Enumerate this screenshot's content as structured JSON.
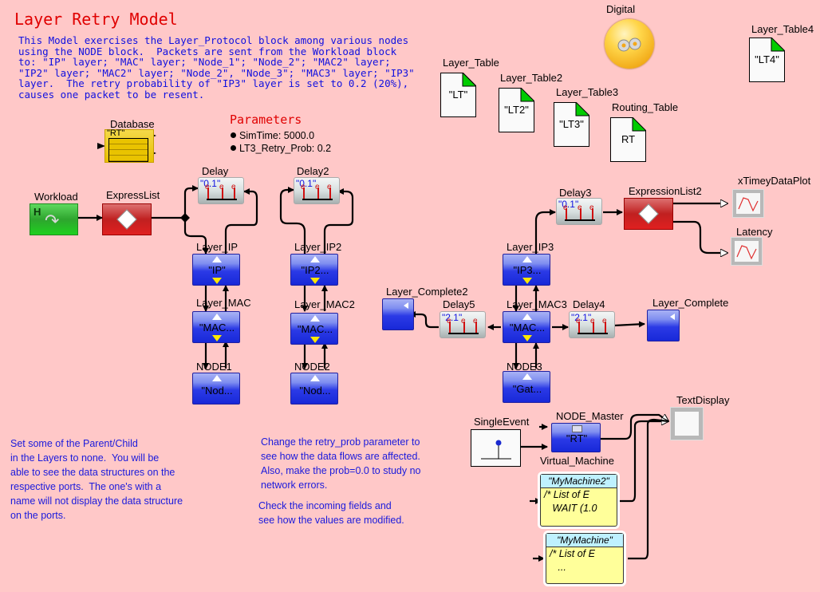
{
  "title": "Layer Retry Model",
  "description": "This Model exercises the Layer_Protocol block among various nodes\nusing the NODE block.  Packets are sent from the Workload block\nto: \"IP\" layer; \"MAC\" layer; \"Node_1\"; \"Node_2\"; \"MAC2\" layer;\n\"IP2\" layer; \"MAC2\" layer; \"Node_2\", \"Node_3\"; \"MAC3\" layer; \"IP3\"\nlayer.  The retry probability of \"IP3\" layer is set to 0.2 (20%),\ncauses one packet to be resent.",
  "parameters": {
    "title": "Parameters",
    "items": [
      "SimTime: 5000.0",
      "LT3_Retry_Prob: 0.2"
    ]
  },
  "digital": {
    "label": "Digital",
    "icon": "gears-icon"
  },
  "tables": [
    {
      "label": "Layer_Table",
      "value": "\"LT\""
    },
    {
      "label": "Layer_Table2",
      "value": "\"LT2\""
    },
    {
      "label": "Layer_Table3",
      "value": "\"LT3\""
    },
    {
      "label": "Routing_Table",
      "value": "RT"
    },
    {
      "label": "Layer_Table4",
      "value": "\"LT4\""
    }
  ],
  "database": {
    "label": "Database",
    "value": "\"RT\""
  },
  "workload": {
    "label": "Workload",
    "glyph": "H"
  },
  "expresslist": {
    "label": "ExpressList"
  },
  "expresslist2": {
    "label": "ExpressionList2"
  },
  "delays": [
    {
      "label": "Delay",
      "value": "\"0.1\""
    },
    {
      "label": "Delay2",
      "value": "\"0.1\""
    },
    {
      "label": "Delay3",
      "value": "\"0.1\""
    },
    {
      "label": "Delay4",
      "value": "\"2.1\""
    },
    {
      "label": "Delay5",
      "value": "\"2.1\""
    }
  ],
  "layers": [
    {
      "label": "Layer_IP",
      "value": "\"IP\""
    },
    {
      "label": "Layer_MAC",
      "value": "\"MAC..."
    },
    {
      "label": "NODE1",
      "value": "\"Nod..."
    },
    {
      "label": "Layer_IP2",
      "value": "\"IP2..."
    },
    {
      "label": "Layer_MAC2",
      "value": "\"MAC..."
    },
    {
      "label": "NODE2",
      "value": "\"Nod..."
    },
    {
      "label": "Layer_IP3",
      "value": "\"IP3..."
    },
    {
      "label": "Layer_MAC3",
      "value": "\"MAC..."
    },
    {
      "label": "NODE3",
      "value": "\"Gat..."
    }
  ],
  "completes": [
    {
      "label": "Layer_Complete2"
    },
    {
      "label": "Layer_Complete"
    }
  ],
  "plots": [
    {
      "label": "xTimeyDataPlot"
    },
    {
      "label": "Latency"
    }
  ],
  "single_event": {
    "label": "SingleEvent"
  },
  "node_master": {
    "label": "NODE_Master",
    "value": "\"RT\"",
    "sublabel": "Virtual_Machine"
  },
  "text_display": {
    "label": "TextDisplay"
  },
  "machines": [
    {
      "name": "\"MyMachine2\"",
      "body": "/* List of E\n   WAIT (1.0"
    },
    {
      "name": "\"MyMachine\"",
      "body": "/* List of E\n   ..."
    }
  ],
  "notes": {
    "left": "Set some of the Parent/Child\nin the Layers to none.  You will be\nable to see the data structures on the\nrespective ports.  The one's with a\nname will not display the data structure\non the ports.",
    "middle1": "Change the retry_prob parameter to\nsee how the data flows are affected.\nAlso, make the prob=0.0 to study no\nnetwork errors.",
    "middle2": "Check the incoming fields and\nsee how the values are modified."
  }
}
